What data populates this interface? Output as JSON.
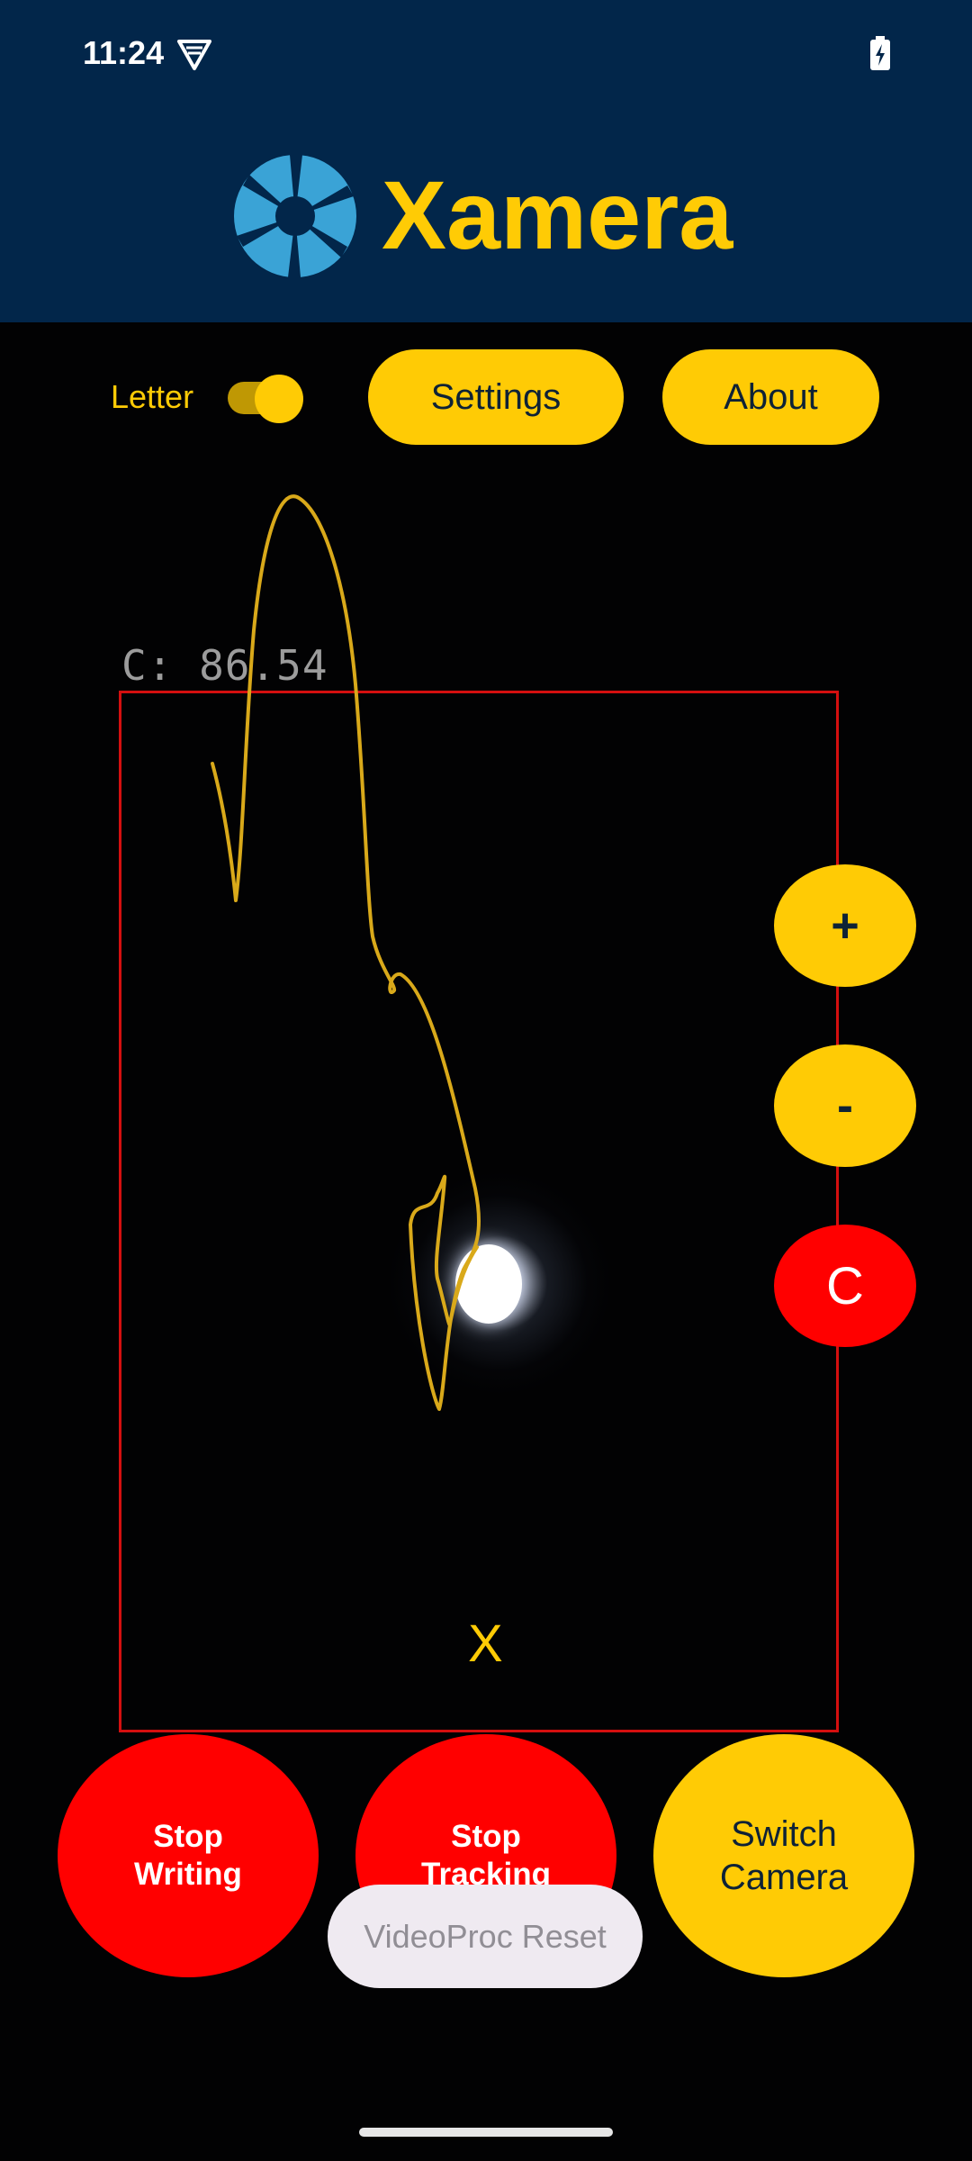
{
  "status_bar": {
    "time": "11:24"
  },
  "header": {
    "title": "Xamera"
  },
  "controls": {
    "letter_label": "Letter",
    "letter_toggle_on": true,
    "settings_label": "Settings",
    "about_label": "About"
  },
  "camera": {
    "confidence_text": "C: 86.54",
    "detected_letter": "X"
  },
  "side_buttons": {
    "zoom_in": "+",
    "zoom_out": "-",
    "clear": "C"
  },
  "bottom_buttons": {
    "stop_writing": "Stop\nWriting",
    "stop_tracking": "Stop\nTracking",
    "switch_camera": "Switch\nCamera"
  },
  "toast": {
    "text": "VideoProc Reset"
  },
  "colors": {
    "header_bg": "#02264a",
    "accent": "#ffcb05",
    "danger": "#ff0000",
    "box_border": "#d40f0f"
  }
}
